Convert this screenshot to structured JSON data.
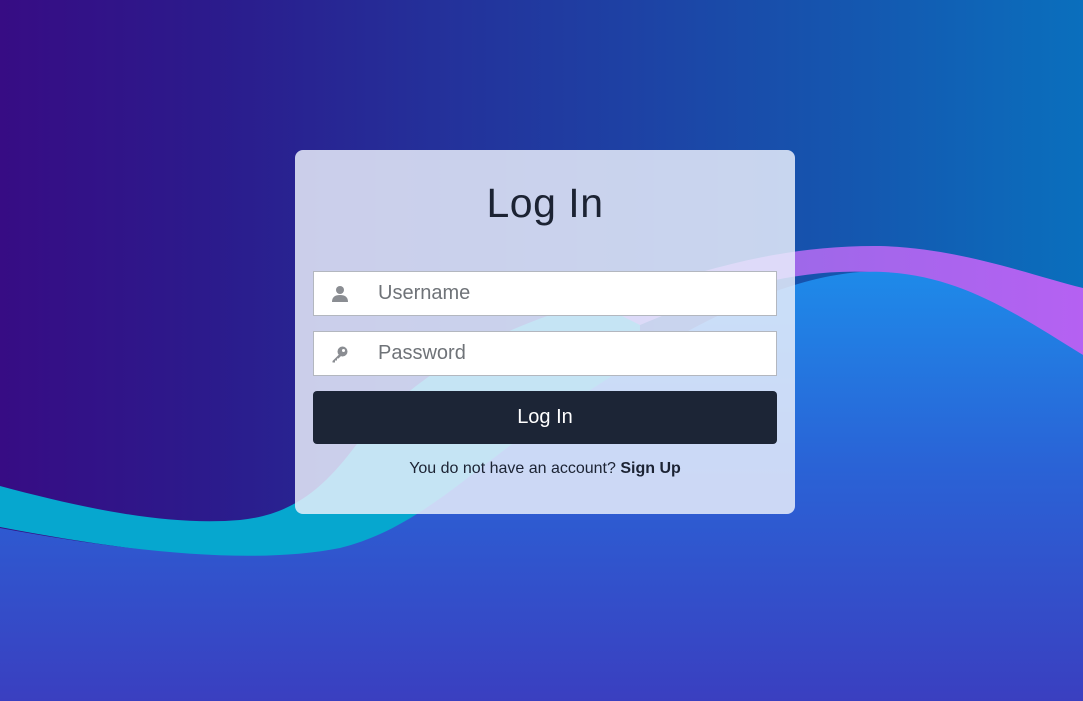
{
  "login": {
    "title": "Log In",
    "username_placeholder": "Username",
    "password_placeholder": "Password",
    "button_label": "Log In",
    "signup_prompt": "You do not have an account?",
    "signup_link": "Sign Up"
  },
  "icons": {
    "username": "user-icon",
    "password": "key-icon"
  },
  "colors": {
    "button": "#1c2536",
    "text": "#1c2333",
    "wave_cyan": "#00a6cf",
    "wave_purple": "#b663f0",
    "wave_blue": "#1f8ae8"
  }
}
